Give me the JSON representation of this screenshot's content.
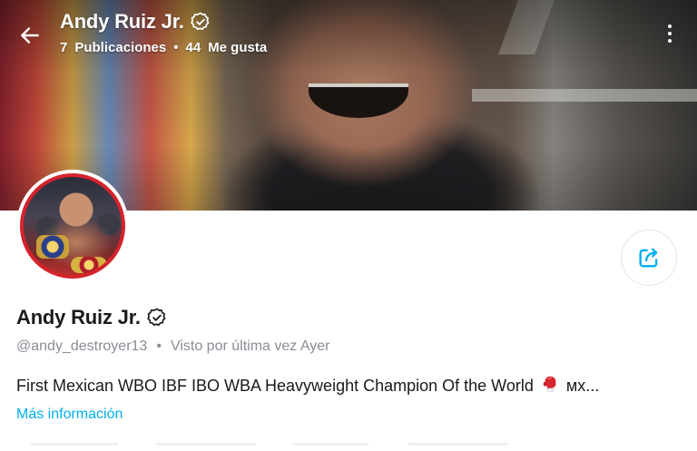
{
  "header": {
    "title": "Andy Ruiz Jr.",
    "stats": {
      "posts_count": "7",
      "posts_label": "Publicaciones",
      "separator": "•",
      "likes_count": "44",
      "likes_label": "Me gusta"
    }
  },
  "profile": {
    "name": "Andy Ruiz Jr.",
    "handle": "@andy_destroyer13",
    "separator": "•",
    "last_seen": "Visto por última vez Ayer",
    "bio": "First Mexican WBO IBF IBO WBA Heavyweight Champion Of the World",
    "bio_suffix": "мх...",
    "more_info": "Más información"
  },
  "icons": {
    "back": "arrow-left-icon",
    "more": "more-vertical-icon",
    "verified": "verified-badge-icon",
    "share": "share-icon",
    "glove": "boxing-glove-icon"
  },
  "colors": {
    "accent": "#00aff0",
    "text": "#1a1a1a",
    "muted": "#8a8d96",
    "avatar_ring": "#d5232c"
  }
}
